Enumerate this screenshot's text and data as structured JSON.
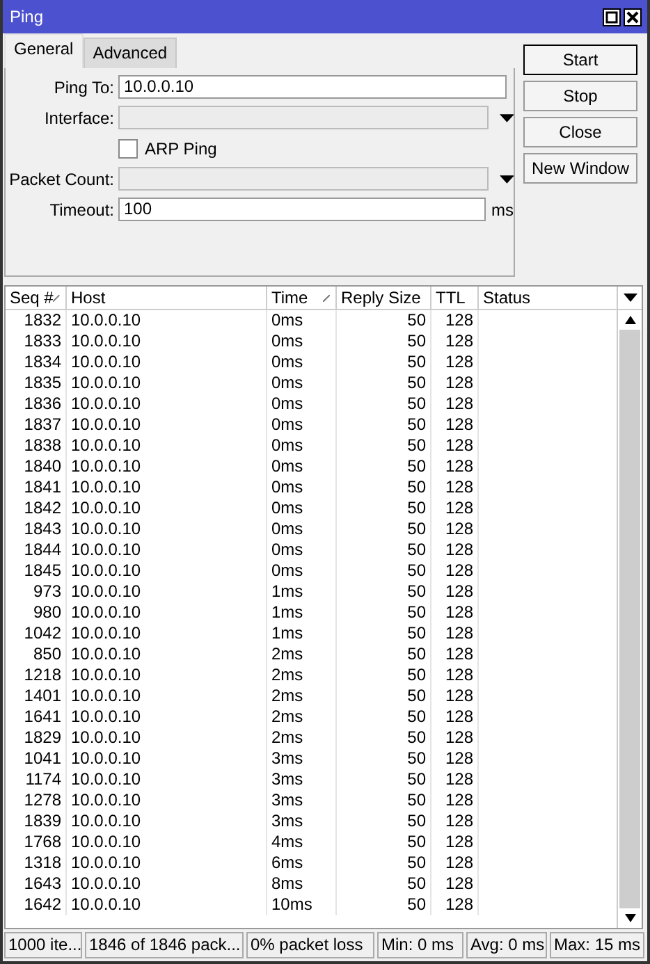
{
  "window": {
    "title": "Ping"
  },
  "tabs": [
    {
      "label": "General",
      "selected": true
    },
    {
      "label": "Advanced",
      "selected": false
    }
  ],
  "form": [
    {
      "kind": "text",
      "label": "Ping To:",
      "value": "10.0.0.10"
    },
    {
      "kind": "dropdown",
      "label": "Interface:"
    },
    {
      "kind": "checkbox",
      "label": "ARP Ping",
      "checked": false
    },
    {
      "kind": "dropdown",
      "label": "Packet Count:"
    },
    {
      "kind": "text",
      "label": "Timeout:",
      "value": "100",
      "unit": "ms"
    }
  ],
  "buttons": [
    {
      "label": "Start",
      "selected": true
    },
    {
      "label": "Stop",
      "selected": false
    },
    {
      "label": "Close",
      "selected": false
    },
    {
      "label": "New Window",
      "selected": false
    }
  ],
  "table": {
    "columns": [
      {
        "label": "Seq #",
        "sorted": true
      },
      {
        "label": "Host",
        "sorted": false
      },
      {
        "label": "Time",
        "sorted": true
      },
      {
        "label": "Reply Size",
        "sorted": false
      },
      {
        "label": "TTL",
        "sorted": false
      },
      {
        "label": "Status",
        "sorted": false
      }
    ],
    "rows": [
      [
        "1832",
        "10.0.0.10",
        "0ms",
        "50",
        "128"
      ],
      [
        "1833",
        "10.0.0.10",
        "0ms",
        "50",
        "128"
      ],
      [
        "1834",
        "10.0.0.10",
        "0ms",
        "50",
        "128"
      ],
      [
        "1835",
        "10.0.0.10",
        "0ms",
        "50",
        "128"
      ],
      [
        "1836",
        "10.0.0.10",
        "0ms",
        "50",
        "128"
      ],
      [
        "1837",
        "10.0.0.10",
        "0ms",
        "50",
        "128"
      ],
      [
        "1838",
        "10.0.0.10",
        "0ms",
        "50",
        "128"
      ],
      [
        "1840",
        "10.0.0.10",
        "0ms",
        "50",
        "128"
      ],
      [
        "1841",
        "10.0.0.10",
        "0ms",
        "50",
        "128"
      ],
      [
        "1842",
        "10.0.0.10",
        "0ms",
        "50",
        "128"
      ],
      [
        "1843",
        "10.0.0.10",
        "0ms",
        "50",
        "128"
      ],
      [
        "1844",
        "10.0.0.10",
        "0ms",
        "50",
        "128"
      ],
      [
        "1845",
        "10.0.0.10",
        "0ms",
        "50",
        "128"
      ],
      [
        "973",
        "10.0.0.10",
        "1ms",
        "50",
        "128"
      ],
      [
        "980",
        "10.0.0.10",
        "1ms",
        "50",
        "128"
      ],
      [
        "1042",
        "10.0.0.10",
        "1ms",
        "50",
        "128"
      ],
      [
        "850",
        "10.0.0.10",
        "2ms",
        "50",
        "128"
      ],
      [
        "1218",
        "10.0.0.10",
        "2ms",
        "50",
        "128"
      ],
      [
        "1401",
        "10.0.0.10",
        "2ms",
        "50",
        "128"
      ],
      [
        "1641",
        "10.0.0.10",
        "2ms",
        "50",
        "128"
      ],
      [
        "1829",
        "10.0.0.10",
        "2ms",
        "50",
        "128"
      ],
      [
        "1041",
        "10.0.0.10",
        "3ms",
        "50",
        "128"
      ],
      [
        "1174",
        "10.0.0.10",
        "3ms",
        "50",
        "128"
      ],
      [
        "1278",
        "10.0.0.10",
        "3ms",
        "50",
        "128"
      ],
      [
        "1839",
        "10.0.0.10",
        "3ms",
        "50",
        "128"
      ],
      [
        "1768",
        "10.0.0.10",
        "4ms",
        "50",
        "128"
      ],
      [
        "1318",
        "10.0.0.10",
        "6ms",
        "50",
        "128"
      ],
      [
        "1643",
        "10.0.0.10",
        "8ms",
        "50",
        "128"
      ],
      [
        "1642",
        "10.0.0.10",
        "10ms",
        "50",
        "128"
      ]
    ]
  },
  "status_bar": [
    "1000 ite...",
    "1846 of 1846 pack...",
    "0% packet loss",
    "Min: 0 ms",
    "Avg: 0 ms",
    "Max: 15 ms"
  ]
}
